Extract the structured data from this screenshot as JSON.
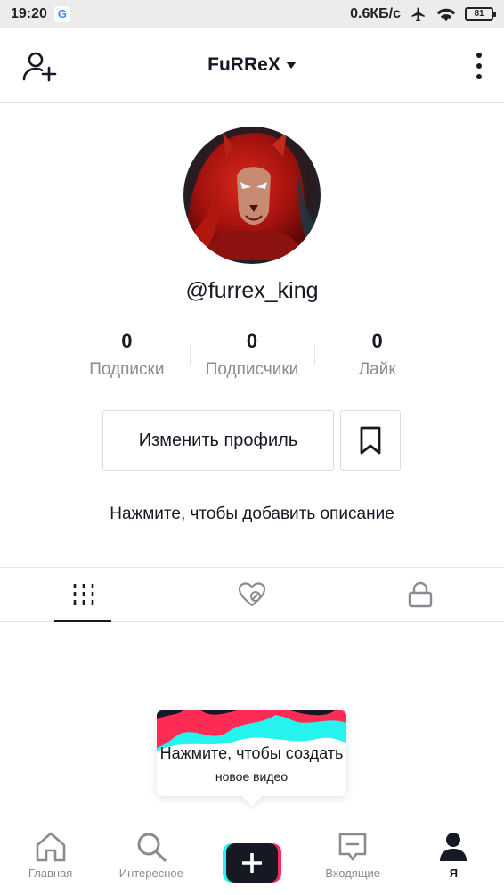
{
  "status_bar": {
    "time": "19:20",
    "google_badge": "G",
    "network_speed": "0.6КБ/с",
    "battery": "81"
  },
  "header": {
    "title": "FuRReX"
  },
  "profile": {
    "username": "@furrex_king",
    "stats": [
      {
        "value": "0",
        "label": "Подписки"
      },
      {
        "value": "0",
        "label": "Подписчики"
      },
      {
        "value": "0",
        "label": "Лайк"
      }
    ],
    "edit_button_label": "Изменить профиль",
    "bio_hint": "Нажмите, чтобы добавить описание"
  },
  "tabs": [
    {
      "icon": "grid-icon",
      "active": true
    },
    {
      "icon": "liked-heart-icon",
      "active": false
    },
    {
      "icon": "lock-icon",
      "active": false
    }
  ],
  "create_popup": {
    "title": "Нажмите, чтобы создать",
    "subtitle": "новое видео"
  },
  "bottom_nav": [
    {
      "label": "Главная",
      "icon": "home-icon"
    },
    {
      "label": "Интересное",
      "icon": "search-icon"
    },
    {
      "label": "",
      "icon": "plus-icon"
    },
    {
      "label": "Входящие",
      "icon": "inbox-icon"
    },
    {
      "label": "Я",
      "icon": "profile-icon"
    }
  ],
  "colors": {
    "text_primary": "#161823",
    "text_secondary": "#8a8b91",
    "cyan": "#25f4ee",
    "red": "#fe2c55"
  }
}
